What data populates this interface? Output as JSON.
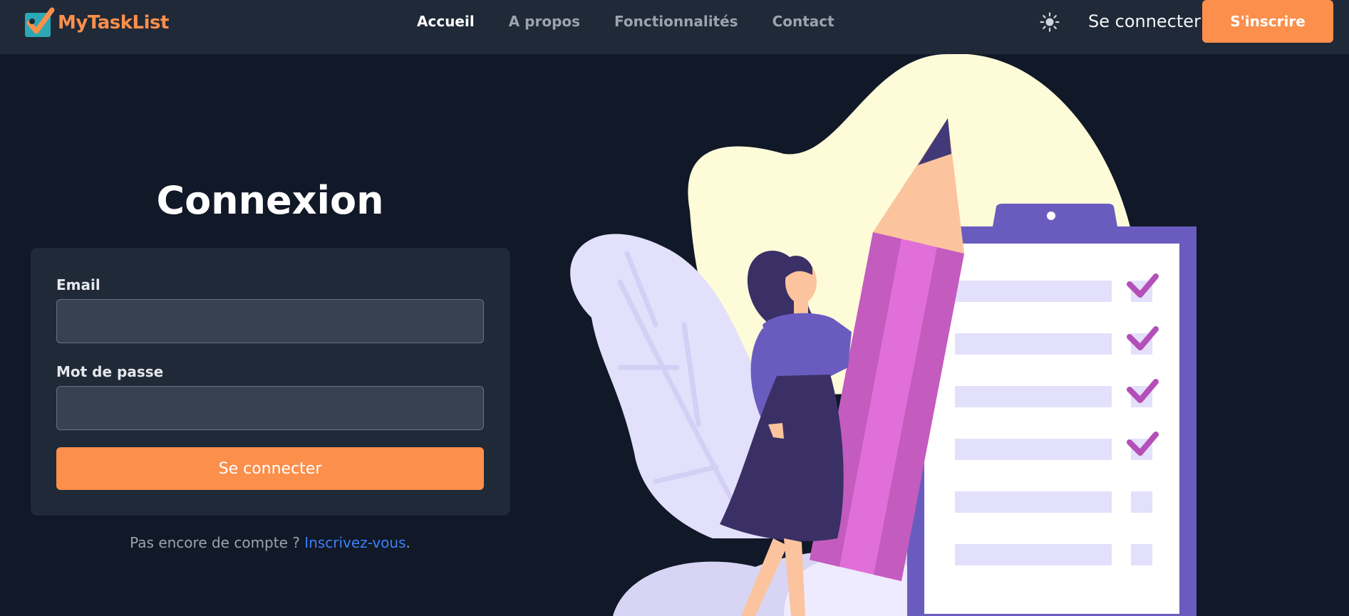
{
  "brand": {
    "name": "MyTaskList",
    "color": "#fb8f4b"
  },
  "nav": {
    "links": [
      {
        "label": "Accueil",
        "active": true
      },
      {
        "label": "A propos",
        "active": false
      },
      {
        "label": "Fonctionnalités",
        "active": false
      },
      {
        "label": "Contact",
        "active": false
      }
    ],
    "theme_icon": "sun-icon",
    "login_label": "Se connecter",
    "signup_label": "S'inscrire"
  },
  "login": {
    "title": "Connexion",
    "email_label": "Email",
    "email_value": "",
    "password_label": "Mot de passe",
    "password_value": "",
    "submit_label": "Se connecter",
    "signup_prompt": "Pas encore de compte ? ",
    "signup_link": "Inscrivez-vous",
    "signup_suffix": "."
  },
  "colors": {
    "background": "#111827",
    "surface": "#1f2937",
    "accent": "#fb8f4b",
    "link": "#3b82f6"
  }
}
